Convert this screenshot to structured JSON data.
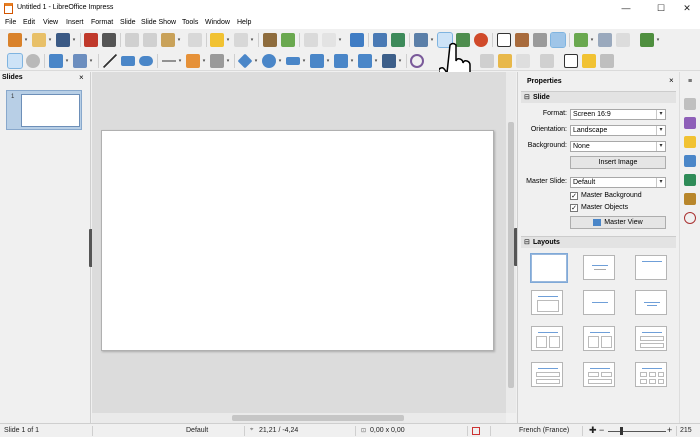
{
  "window": {
    "title": "Untitled 1 - LibreOffice Impress",
    "minimize": "—",
    "maximize": "☐",
    "close": "✕"
  },
  "menu": [
    "File",
    "Edit",
    "View",
    "Insert",
    "Format",
    "Slide",
    "Slide Show",
    "Tools",
    "Window",
    "Help"
  ],
  "slides_panel": {
    "title": "Slides",
    "close": "×",
    "thumb_number": "1"
  },
  "properties": {
    "title": "Properties",
    "close": "×",
    "slide_section": "Slide",
    "format_label": "Format:",
    "format_value": "Screen 16:9",
    "orientation_label": "Orientation:",
    "orientation_value": "Landscape",
    "background_label": "Background:",
    "background_value": "None",
    "insert_image": "Insert Image",
    "master_slide_label": "Master Slide:",
    "master_slide_value": "Default",
    "master_background": "Master Background",
    "master_objects": "Master Objects",
    "master_view": "Master View",
    "layouts_section": "Layouts",
    "collapse_glyph": "⊟"
  },
  "status": {
    "slide": "Slide 1 of 1",
    "master": "Default",
    "position": "21,21 / -4,24",
    "size": "0,00 x 0,00",
    "language": "French (France)",
    "zoom_minus": "−",
    "zoom_plus": "+",
    "zoom": "215"
  },
  "colors": {
    "accent": "#4a86c8",
    "selection": "#cde3f7",
    "slide_thumb_bg": "#b8cfe6"
  }
}
